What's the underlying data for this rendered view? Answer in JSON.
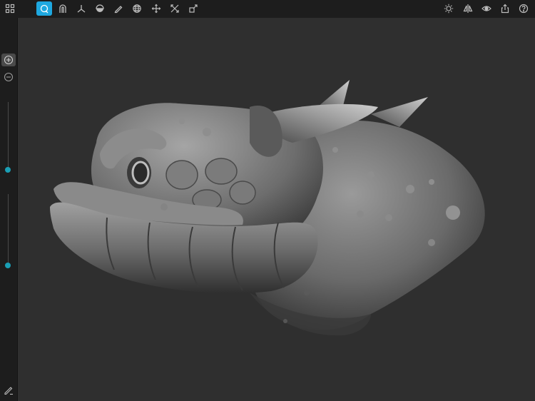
{
  "toolbar": {
    "left_tools": [
      {
        "icon": "grid-icon"
      },
      {
        "icon": "sculpt-brush-icon",
        "active": true
      },
      {
        "icon": "magnet-icon"
      },
      {
        "icon": "axis-icon"
      },
      {
        "icon": "hemisphere-icon"
      },
      {
        "icon": "pencil-icon"
      },
      {
        "icon": "globe-icon"
      },
      {
        "icon": "move-icon"
      },
      {
        "icon": "transform-icon"
      },
      {
        "icon": "scale-icon"
      }
    ],
    "right_tools": [
      {
        "icon": "sun-icon"
      },
      {
        "icon": "symmetry-icon"
      },
      {
        "icon": "eye-icon"
      },
      {
        "icon": "share-icon"
      },
      {
        "icon": "help-icon"
      }
    ]
  },
  "sidebar": {
    "zoom_in": "zoom-in-icon",
    "zoom_out": "zoom-out-icon",
    "radius_slider_value": 0.5,
    "intensity_slider_value": 0.5,
    "bottom_tool": "brush-settings-icon"
  },
  "colors": {
    "accent": "#1ea8e0",
    "slider_knob": "#1a9fb5",
    "background": "#2f2f2f",
    "chrome": "#1d1d1d",
    "model": "#7a7a7a"
  }
}
